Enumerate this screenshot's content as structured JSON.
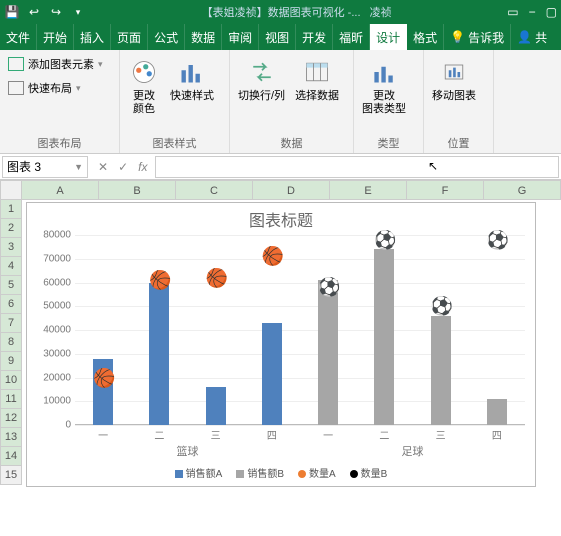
{
  "titlebar": {
    "docname": "【表姐凌祯】数据图表可视化 -...",
    "username": "凌祯"
  },
  "tabs": {
    "file": "文件",
    "home": "开始",
    "insert": "插入",
    "page": "页面",
    "formula": "公式",
    "data": "数据",
    "review": "审阅",
    "view": "视图",
    "dev": "开发",
    "foxit": "福昕",
    "design": "设计",
    "format": "格式",
    "tellme": "告诉我",
    "share": "共"
  },
  "ribbon": {
    "add_element": "添加图表元素",
    "quick_layout": "快速布局",
    "group_layout": "图表布局",
    "change_colors": "更改\n颜色",
    "quick_styles": "快速样式",
    "group_styles": "图表样式",
    "switch_rc": "切换行/列",
    "select_data": "选择数据",
    "group_data": "数据",
    "change_type": "更改\n图表类型",
    "group_type": "类型",
    "move_chart": "移动图表",
    "group_loc": "位置"
  },
  "formulabar": {
    "namebox": "图表 3",
    "fx": "fx"
  },
  "columns": [
    "A",
    "B",
    "C",
    "D",
    "E",
    "F",
    "G"
  ],
  "rows": [
    "1",
    "2",
    "3",
    "4",
    "5",
    "6",
    "7",
    "8",
    "9",
    "10",
    "11",
    "12",
    "13",
    "14",
    "15"
  ],
  "chart": {
    "title": "图表标题",
    "legend": {
      "a": "销售额A",
      "b": "销售额B",
      "qa": "数量A",
      "qb": "数量B"
    }
  },
  "chart_data": {
    "type": "bar",
    "title": "图表标题",
    "ylim": [
      0,
      80000
    ],
    "yticks": [
      0,
      10000,
      20000,
      30000,
      40000,
      50000,
      60000,
      70000,
      80000
    ],
    "groups": [
      "篮球",
      "足球"
    ],
    "categories": [
      "一",
      "二",
      "三",
      "四"
    ],
    "series": [
      {
        "name": "销售额A",
        "group": "篮球",
        "type": "bar",
        "color": "#4f81bd",
        "values": [
          28000,
          60000,
          16000,
          43000
        ]
      },
      {
        "name": "销售额B",
        "group": "足球",
        "type": "bar",
        "color": "#a6a6a6",
        "values": [
          61000,
          74000,
          46000,
          11000
        ]
      },
      {
        "name": "数量A",
        "group": "篮球",
        "type": "marker",
        "icon": "🏀",
        "values": [
          20000,
          61000,
          62000,
          71000
        ]
      },
      {
        "name": "数量B",
        "group": "足球",
        "type": "marker",
        "icon": "⚽",
        "values": [
          58000,
          78000,
          50000,
          78000
        ]
      }
    ]
  }
}
